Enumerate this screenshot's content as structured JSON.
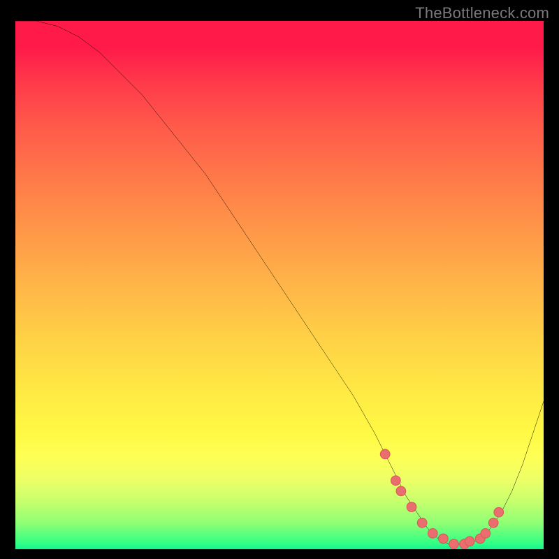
{
  "watermark": "TheBottleneck.com",
  "colors": {
    "frame_bg": "#000000",
    "curve_color": "#000000",
    "marker_fill": "#eb6e6e",
    "marker_stroke": "#d85a5a"
  },
  "chart_data": {
    "type": "line",
    "title": "",
    "xlabel": "",
    "ylabel": "",
    "xlim": [
      0,
      100
    ],
    "ylim": [
      0,
      100
    ],
    "grid": false,
    "legend": false,
    "series": [
      {
        "name": "bottleneck-curve",
        "x": [
          0,
          4,
          8,
          12,
          16,
          20,
          24,
          28,
          32,
          36,
          40,
          44,
          48,
          52,
          56,
          60,
          64,
          68,
          70,
          72,
          74,
          76,
          78,
          80,
          82,
          84,
          86,
          88,
          90,
          92,
          94,
          96,
          98,
          100
        ],
        "y": [
          100,
          100,
          99,
          97,
          94,
          90,
          86,
          81,
          76,
          71,
          65,
          59,
          53,
          47,
          41,
          35,
          29,
          22,
          18,
          14,
          10,
          7,
          4,
          2,
          1,
          1,
          1,
          2,
          4,
          7,
          11,
          16,
          22,
          28
        ]
      }
    ],
    "markers": {
      "name": "highlight-dots",
      "x": [
        70,
        72,
        73,
        75,
        77,
        79,
        81,
        83,
        85,
        86,
        88,
        89,
        90.5,
        91.5
      ],
      "y": [
        18,
        13,
        11,
        8,
        5,
        3,
        2,
        1,
        1,
        1.5,
        2,
        3,
        5,
        7
      ]
    },
    "gradient_stops": [
      {
        "pct": 0,
        "color": "#ff1a4a"
      },
      {
        "pct": 25,
        "color": "#ff6b49"
      },
      {
        "pct": 50,
        "color": "#ffb548"
      },
      {
        "pct": 75,
        "color": "#fff944"
      },
      {
        "pct": 92,
        "color": "#b7ff6c"
      },
      {
        "pct": 100,
        "color": "#14f38e"
      }
    ]
  }
}
